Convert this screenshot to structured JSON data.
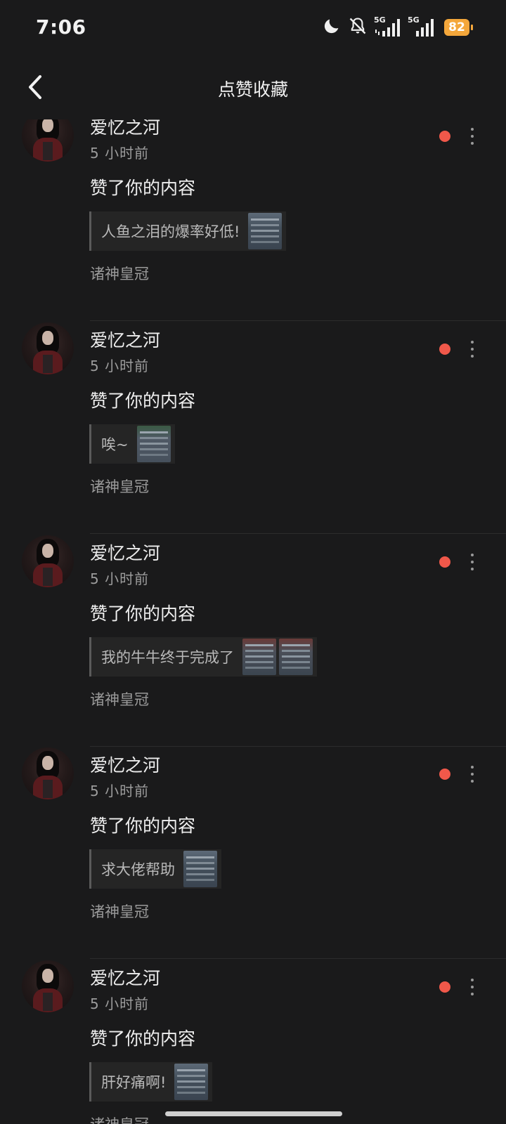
{
  "status_bar": {
    "time": "7:06",
    "network_1": "5G",
    "network_2": "5G",
    "battery": "82",
    "icons": [
      "moon-icon",
      "mute-bell-icon",
      "signal-icon",
      "signal-icon",
      "battery-icon"
    ]
  },
  "header": {
    "title": "点赞收藏",
    "back_icon": "chevron-left-icon"
  },
  "notifications": [
    {
      "username": "爱忆之河",
      "time_ago": "5 小时前",
      "action": "赞了你的内容",
      "content": "人鱼之泪的爆率好低!",
      "category": "诸神皇冠",
      "unread": true
    },
    {
      "username": "爱忆之河",
      "time_ago": "5 小时前",
      "action": "赞了你的内容",
      "content": "唉~",
      "category": "诸神皇冠",
      "unread": true
    },
    {
      "username": "爱忆之河",
      "time_ago": "5 小时前",
      "action": "赞了你的内容",
      "content": "我的牛牛终于完成了",
      "category": "诸神皇冠",
      "unread": true
    },
    {
      "username": "爱忆之河",
      "time_ago": "5 小时前",
      "action": "赞了你的内容",
      "content": "求大佬帮助",
      "category": "诸神皇冠",
      "unread": true
    },
    {
      "username": "爱忆之河",
      "time_ago": "5 小时前",
      "action": "赞了你的内容",
      "content": "肝好痛啊!",
      "category": "诸神皇冠",
      "unread": true
    }
  ],
  "colors": {
    "background": "#1a1a1b",
    "unread_dot": "#f0584a",
    "battery": "#f4a73b"
  }
}
